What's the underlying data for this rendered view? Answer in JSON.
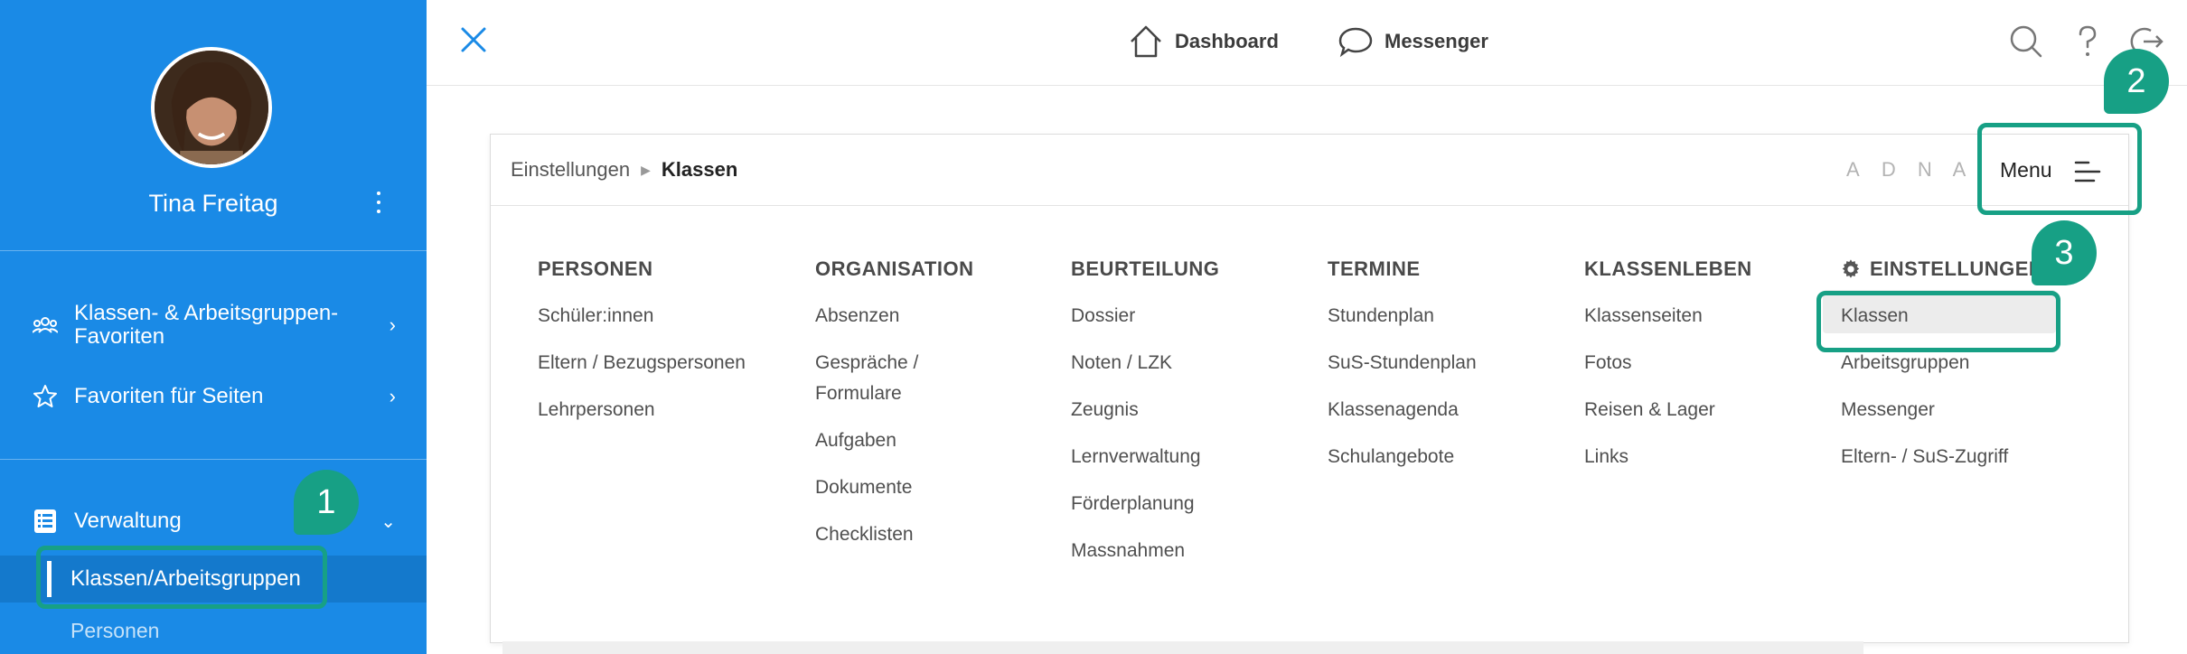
{
  "sidebar": {
    "user_name": "Tina Freitag",
    "items": [
      {
        "label": "Klassen- & Arbeitsgruppen-Favoriten",
        "icon": "group-icon"
      },
      {
        "label": "Favoriten für Seiten",
        "icon": "star-icon"
      },
      {
        "label": "Verwaltung",
        "icon": "list-icon"
      }
    ],
    "sub_items": [
      {
        "label": "Klassen/Arbeitsgruppen",
        "active": true
      },
      {
        "label": "Personen",
        "active": false
      }
    ]
  },
  "topbar": {
    "nav": [
      {
        "label": "Dashboard",
        "icon": "home-icon"
      },
      {
        "label": "Messenger",
        "icon": "chat-bubble-icon"
      }
    ],
    "icons": [
      "search-icon",
      "help-icon",
      "logout-icon"
    ]
  },
  "breadcrumb": {
    "parent": "Einstellungen",
    "current": "Klassen"
  },
  "font_letters": [
    "A",
    "D",
    "N",
    "A"
  ],
  "menu_label": "Menu",
  "menu_columns": [
    {
      "heading": "PERSONEN",
      "items": [
        "Schüler:innen",
        "Eltern / Bezugspersonen",
        "Lehrpersonen"
      ]
    },
    {
      "heading": "ORGANISATION",
      "items": [
        "Absenzen",
        "Gespräche / Formulare",
        "Aufgaben",
        "Dokumente",
        "Checklisten"
      ]
    },
    {
      "heading": "BEURTEILUNG",
      "items": [
        "Dossier",
        "Noten / LZK",
        "Zeugnis",
        "Lernverwaltung",
        "Förderplanung",
        "Massnahmen"
      ]
    },
    {
      "heading": "TERMINE",
      "items": [
        "Stundenplan",
        "SuS-Stundenplan",
        "Klassenagenda",
        "Schulangebote"
      ]
    },
    {
      "heading": "KLASSENLEBEN",
      "items": [
        "Klassenseiten",
        "Fotos",
        "Reisen & Lager",
        "Links"
      ]
    },
    {
      "heading": "EINSTELLUNGEN",
      "items": [
        "Klassen",
        "Arbeitsgruppen",
        "Messenger",
        "Eltern- / SuS-Zugriff"
      ]
    }
  ],
  "callouts": [
    "1",
    "2",
    "3"
  ],
  "colors": {
    "sidebar": "#1a8ae6",
    "accent": "#17a085",
    "close_icon": "#1a8ae6"
  }
}
